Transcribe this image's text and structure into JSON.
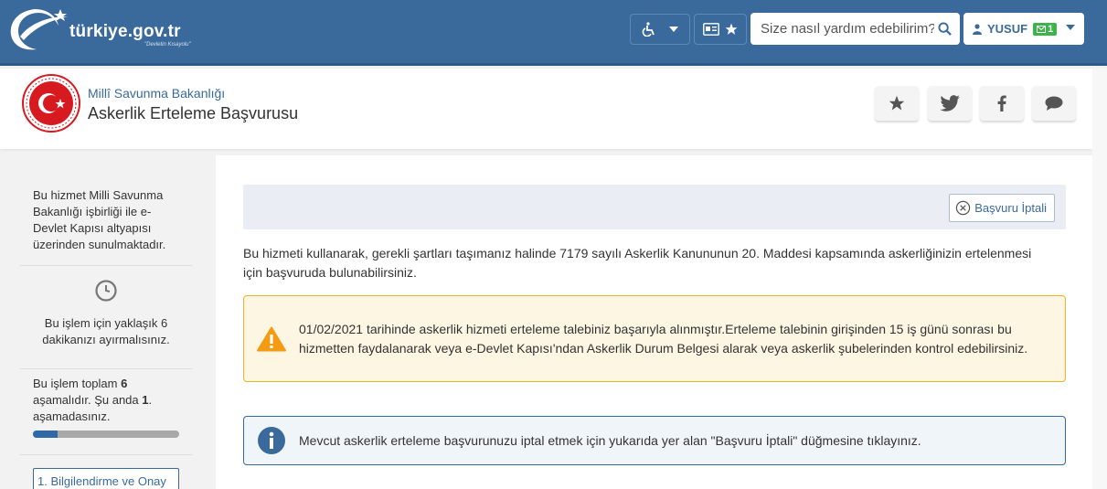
{
  "topbar": {
    "logo_text": "türkiye.gov.tr",
    "logo_sub": "\"Devletin Kısayolu\"",
    "accessibility_icon": "wheelchair-icon",
    "search_placeholder": "Size nasıl yardım edebilirim?",
    "user_name": "YUSUF",
    "message_count": "1",
    "colors": {
      "bar": "#3a6a9c",
      "badge": "#3cb44b"
    }
  },
  "header": {
    "ministry": "Millî Savunma Bakanlığı",
    "service_title": "Askerlik Erteleme Başvurusu",
    "share_icons": [
      "star-icon",
      "twitter-icon",
      "facebook-icon",
      "comment-icon"
    ]
  },
  "sidebar": {
    "partner_text": "Bu hizmet Milli Savunma Bakanlığı işbirliği ile e-Devlet Kapısı altyapısı üzerinden sunulmaktadır.",
    "time_text": "Bu işlem için yaklaşık 6 dakikanızı ayırmalısınız.",
    "steps_text_a": "Bu işlem toplam ",
    "steps_total": "6",
    "steps_text_b": " aşamalıdır. Şu anda ",
    "steps_current": "1",
    "steps_text_c": ". aşamadasınız.",
    "progress_fraction": 0.1667,
    "step_label": "1. Bilgilendirme ve Onay"
  },
  "main": {
    "cancel_label": "Başvuru İptali",
    "intro": "Bu hizmeti kullanarak, gerekli şartları taşımanız halinde 7179 sayılı Askerlik Kanununun 20. Maddesi kapsamında askerliğinizin ertelenmesi için başvuruda bulunabilirsiniz.",
    "warning": "01/02/2021 tarihinde askerlik hizmeti erteleme talebiniz başarıyla alınmıştır.Erteleme talebinin girişinden 15 iş günü sonrası bu hizmetten faydalanarak veya e-Devlet Kapısı'ndan Askerlik Durum Belgesi alarak veya askerlik şubelerinden kontrol edebilirsiniz.",
    "info": "Mevcut askerlik erteleme başvurunuzu iptal etmek için yukarıda yer alan \"Başvuru İptali\" düğmesine tıklayınız.",
    "colors": {
      "warning": "#f0b429",
      "info": "#3a6a9c"
    }
  }
}
